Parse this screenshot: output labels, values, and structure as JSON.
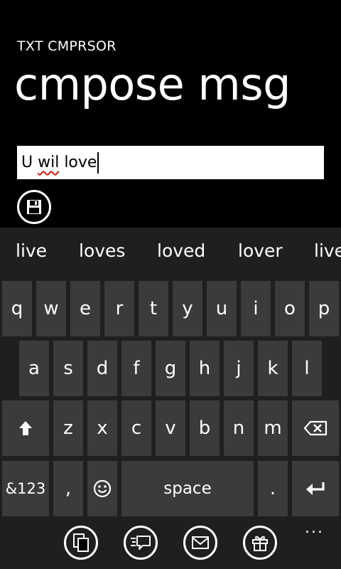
{
  "header": {
    "app_title": "TXT CMPRSOR",
    "page_title": "cmpose msg"
  },
  "message": {
    "words": [
      {
        "text": "U ",
        "misspelled": false
      },
      {
        "text": "wil",
        "misspelled": true
      },
      {
        "text": " love",
        "misspelled": false
      }
    ]
  },
  "save_button": {
    "icon": "save-icon"
  },
  "keyboard": {
    "suggestions": [
      "live",
      "loves",
      "loved",
      "lover",
      "live"
    ],
    "row1": [
      "q",
      "w",
      "e",
      "r",
      "t",
      "y",
      "u",
      "i",
      "o",
      "p"
    ],
    "row2": [
      "a",
      "s",
      "d",
      "f",
      "g",
      "h",
      "j",
      "k",
      "l"
    ],
    "row3": [
      "z",
      "x",
      "c",
      "v",
      "b",
      "n",
      "m"
    ],
    "shift_icon": "shift-arrow-icon",
    "backspace_icon": "backspace-icon",
    "symbols_label": "&123",
    "comma_label": ",",
    "emoji_icon": "smiley-icon",
    "space_label": "space",
    "period_label": ".",
    "enter_icon": "enter-icon"
  },
  "appbar": {
    "buttons": [
      "copy-icon",
      "message-icon",
      "email-icon",
      "gift-icon"
    ],
    "more_label": "..."
  },
  "colors": {
    "background": "#000000",
    "keyboard_bg": "#1f1f1f",
    "key_bg": "#3b3b3b",
    "spell_underline": "#d21a1a"
  }
}
